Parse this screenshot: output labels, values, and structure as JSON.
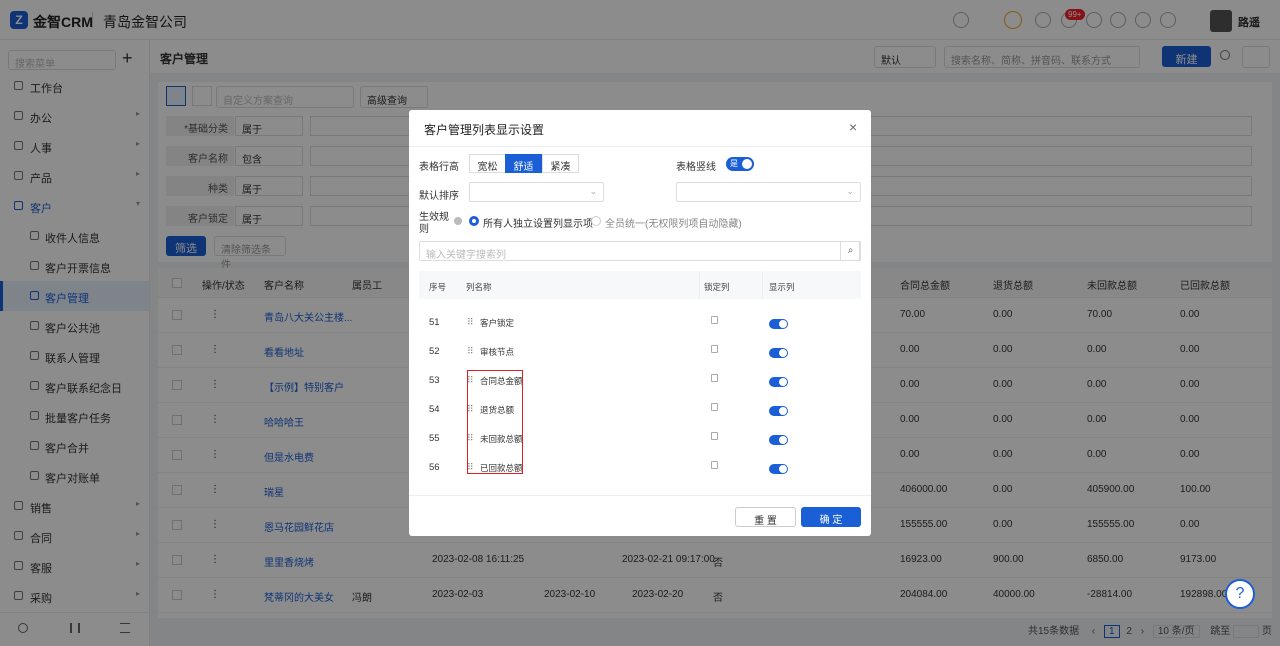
{
  "app": {
    "logo_letter": "Z",
    "name": "金智CRM",
    "company": "青岛金智公司",
    "badge": "99+",
    "user": "路遥"
  },
  "sidebar": {
    "search_placeholder": "搜索菜单",
    "plus": "+",
    "items": [
      {
        "label": "工作台"
      },
      {
        "label": "办公",
        "arrow": "▸"
      },
      {
        "label": "人事",
        "arrow": "▸"
      },
      {
        "label": "产品",
        "arrow": "▸"
      },
      {
        "label": "客户",
        "arrow": "▾"
      },
      {
        "label": "收件人信息"
      },
      {
        "label": "客户开票信息"
      },
      {
        "label": "客户管理"
      },
      {
        "label": "客户公共池"
      },
      {
        "label": "联系人管理"
      },
      {
        "label": "客户联系纪念日"
      },
      {
        "label": "批量客户任务"
      },
      {
        "label": "客户合并"
      },
      {
        "label": "客户对账单"
      },
      {
        "label": "销售",
        "arrow": "▸"
      },
      {
        "label": "合同",
        "arrow": "▸"
      },
      {
        "label": "客服",
        "arrow": "▸"
      },
      {
        "label": "采购",
        "arrow": "▸"
      }
    ]
  },
  "header": {
    "title": "客户管理",
    "view_select": "默认",
    "search_placeholder": "搜索名称、简称、拼音码、联系方式",
    "new_btn": "新建"
  },
  "filters": {
    "custom_query_placeholder": "自定义方案查询",
    "advanced": "高级查询",
    "rows": [
      {
        "label": "*基础分类",
        "op": "属于"
      },
      {
        "label": "客户名称",
        "op": "包含"
      },
      {
        "label": "种类",
        "op": "属于"
      },
      {
        "label": "客户锁定",
        "op": "属于"
      }
    ],
    "filter_btn": "筛选",
    "clear_btn": "清除筛选条件"
  },
  "table": {
    "headers": [
      "操作/状态",
      "客户名称",
      "属员工",
      "合同总金额",
      "退货总额",
      "未回款总额",
      "已回款总额"
    ],
    "rows": [
      {
        "name": "青岛八大关公主楼...",
        "c1": "70.00",
        "c2": "0.00",
        "c3": "70.00",
        "c4": "0.00"
      },
      {
        "name": "看看地址",
        "c1": "0.00",
        "c2": "0.00",
        "c3": "0.00",
        "c4": "0.00"
      },
      {
        "name": "【示例】特别客户",
        "c1": "0.00",
        "c2": "0.00",
        "c3": "0.00",
        "c4": "0.00"
      },
      {
        "name": "哈哈哈王",
        "c1": "0.00",
        "c2": "0.00",
        "c3": "0.00",
        "c4": "0.00"
      },
      {
        "name": "但是水电费",
        "c1": "0.00",
        "c2": "0.00",
        "c3": "0.00",
        "c4": "0.00"
      },
      {
        "name": "瑞星",
        "c1": "406000.00",
        "c2": "0.00",
        "c3": "405900.00",
        "c4": "100.00"
      },
      {
        "name": "恩马花园鲜花店",
        "c1": "155555.00",
        "c2": "0.00",
        "c3": "155555.00",
        "c4": "0.00"
      },
      {
        "name": "里里香烧烤",
        "d1": "2023-02-08 16:11:25",
        "d3": "2023-02-21 09:17:00",
        "flag": "否",
        "c1": "16923.00",
        "c2": "900.00",
        "c3": "6850.00",
        "c4": "9173.00"
      },
      {
        "name": "梵蒂冈的大美女",
        "emp": "冯朗",
        "d1": "2023-02-03",
        "d2": "2023-02-10",
        "d3": "2023-02-20",
        "flag": "否",
        "c1": "204084.00",
        "c2": "40000.00",
        "c3": "-28814.00",
        "c4": "192898.00"
      }
    ]
  },
  "pager": {
    "total": "共15条数据",
    "p1": "1",
    "p2": "2",
    "size": "10 条/页",
    "goto": "跳至",
    "page": "页"
  },
  "modal": {
    "title": "客户管理列表显示设置",
    "close": "×",
    "row_height_label": "表格行高",
    "opt_loose": "宽松",
    "opt_comfort": "舒适",
    "opt_compact": "紧凑",
    "vline_label": "表格竖线",
    "vline_on": "是",
    "sort_label": "默认排序",
    "rule_label_1": "生效规",
    "rule_label_2": "则",
    "rule_opt1": "所有人独立设置列显示项",
    "rule_opt2": "全员统一(无权限列项自动隐藏)",
    "search_placeholder": "输入关键字搜索列",
    "th_no": "序号",
    "th_name": "列名称",
    "th_lock": "锁定列",
    "th_show": "显示列",
    "rows": [
      {
        "no": "51",
        "name": "客户锁定"
      },
      {
        "no": "52",
        "name": "审核节点"
      },
      {
        "no": "53",
        "name": "合同总金额"
      },
      {
        "no": "54",
        "name": "退货总额"
      },
      {
        "no": "55",
        "name": "未回款总额"
      },
      {
        "no": "56",
        "name": "已回款总额"
      }
    ],
    "reset": "重 置",
    "ok": "确 定"
  },
  "help": "?"
}
